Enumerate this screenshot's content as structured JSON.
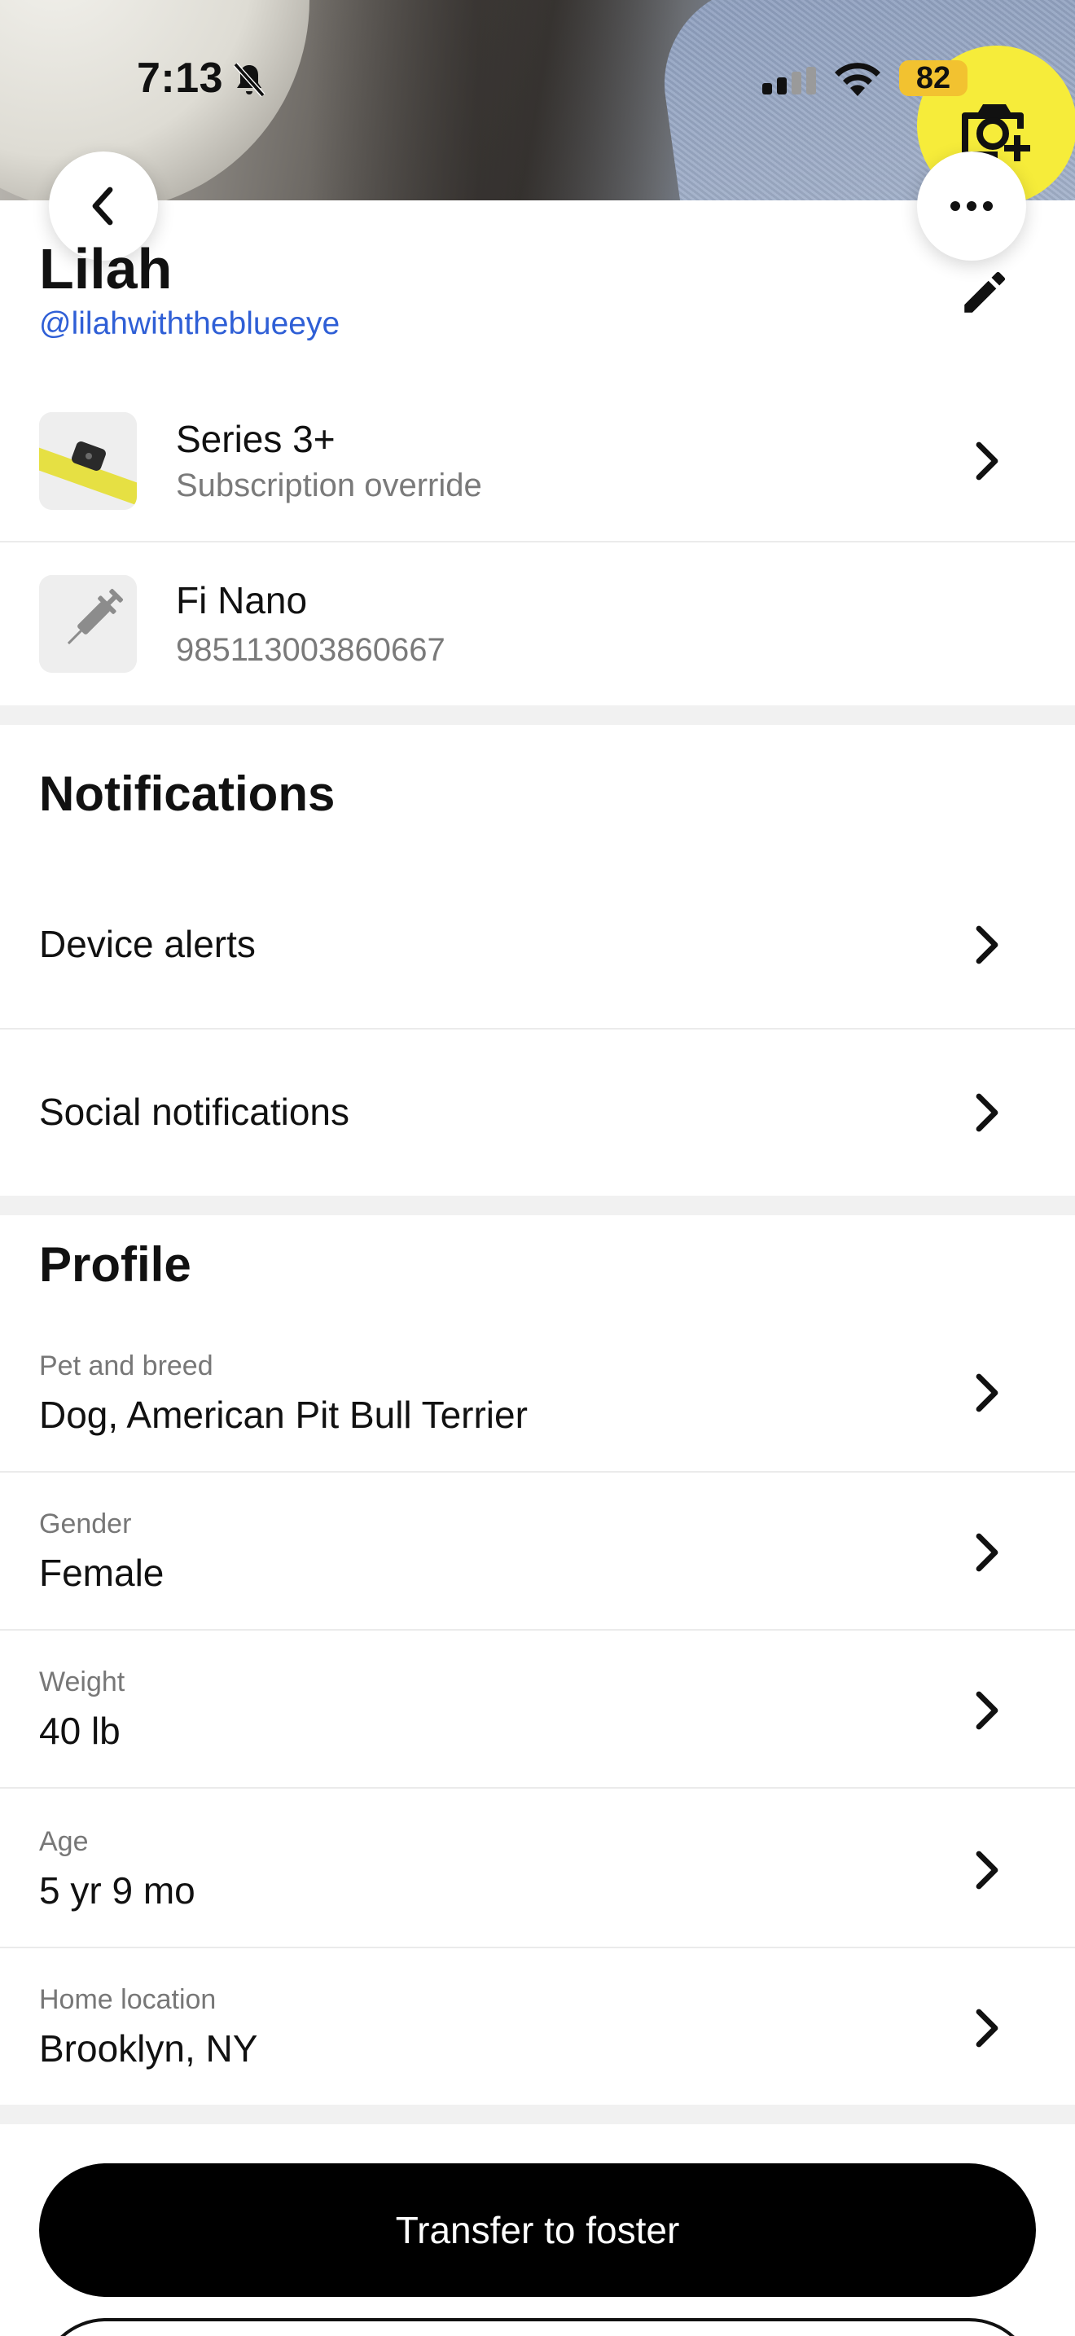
{
  "status_bar": {
    "time": "7:13",
    "battery": "82",
    "icons": [
      "bell-off-icon",
      "cellular-signal-icon",
      "wifi-icon",
      "battery-icon"
    ]
  },
  "header": {
    "back_icon": "chevron-left-icon",
    "more_icon": "ellipsis-icon",
    "camera_icon": "camera-add-icon",
    "camera_button_color": "#f6ec3a"
  },
  "pet": {
    "name": "Lilah",
    "handle": "@lilahwiththeblueeye",
    "edit_icon": "pencil-icon"
  },
  "devices": [
    {
      "title": "Series 3+",
      "subtitle": "Subscription override",
      "icon": "collar-icon"
    },
    {
      "title": "Fi Nano",
      "subtitle": "985113003860667",
      "icon": "syringe-icon"
    }
  ],
  "notifications": {
    "heading": "Notifications",
    "items": [
      {
        "label": "Device alerts"
      },
      {
        "label": "Social notifications"
      }
    ]
  },
  "profile": {
    "heading": "Profile",
    "fields": [
      {
        "caption": "Pet and breed",
        "value": "Dog, American Pit Bull Terrier"
      },
      {
        "caption": "Gender",
        "value": "Female"
      },
      {
        "caption": "Weight",
        "value": "40 lb"
      },
      {
        "caption": "Age",
        "value": "5 yr 9 mo"
      },
      {
        "caption": "Home location",
        "value": "Brooklyn, NY"
      }
    ]
  },
  "actions": {
    "transfer_label": "Transfer to foster"
  },
  "colors": {
    "accent_link": "#2f5fd6",
    "collar_yellow": "#e6e043",
    "primary_button": "#000000"
  }
}
